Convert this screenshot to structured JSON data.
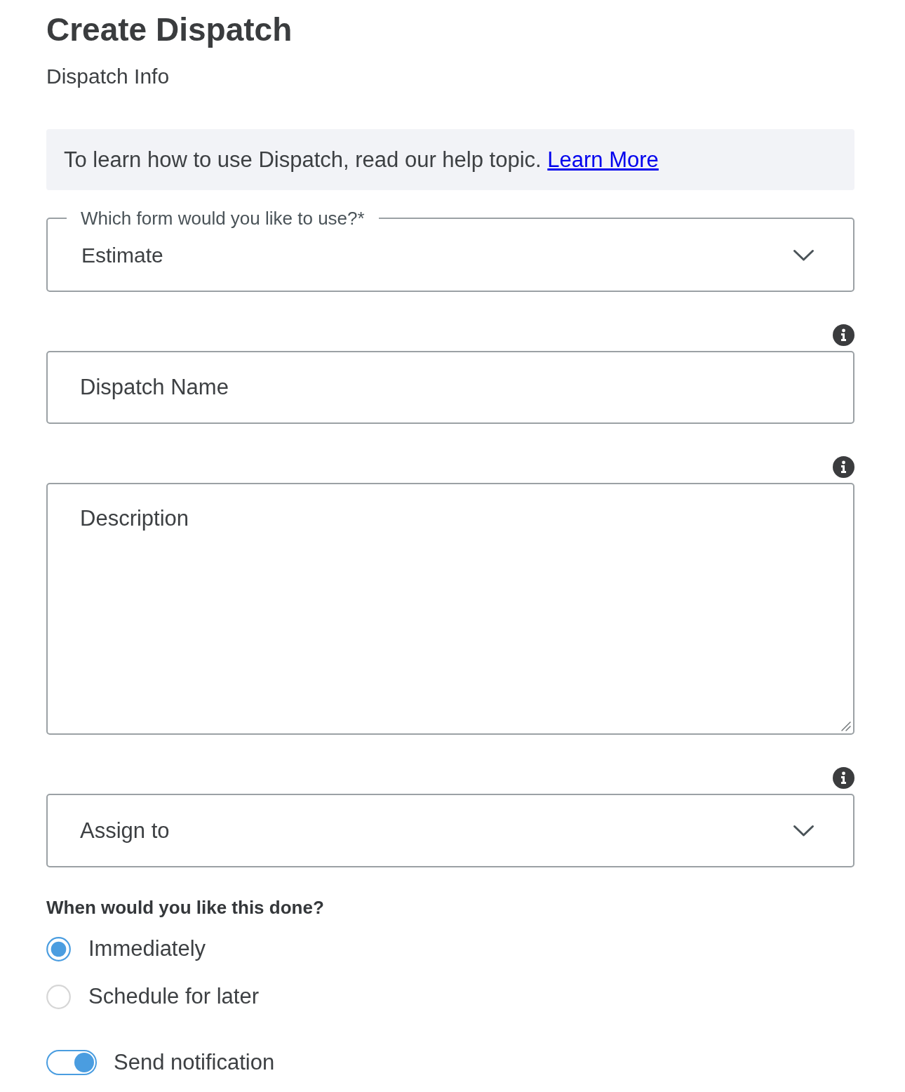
{
  "title": "Create Dispatch",
  "subtitle": "Dispatch Info",
  "banner": {
    "text": "To learn how to use Dispatch, read our help topic.",
    "link": "Learn More"
  },
  "fields": [
    {
      "kind": "select",
      "label": "Which form would you like to use?*",
      "value": "Estimate",
      "info": false
    },
    {
      "kind": "text",
      "placeholder": "Dispatch Name",
      "info": true
    },
    {
      "kind": "textarea",
      "placeholder": "Description",
      "info": true
    },
    {
      "kind": "select",
      "placeholder": "Assign to",
      "info": true
    }
  ],
  "schedule": {
    "question": "When would you like this done?",
    "options": [
      {
        "label": "Immediately",
        "selected": true
      },
      {
        "label": "Schedule for later",
        "selected": false
      }
    ]
  },
  "notification": {
    "label": "Send notification",
    "on": true
  }
}
